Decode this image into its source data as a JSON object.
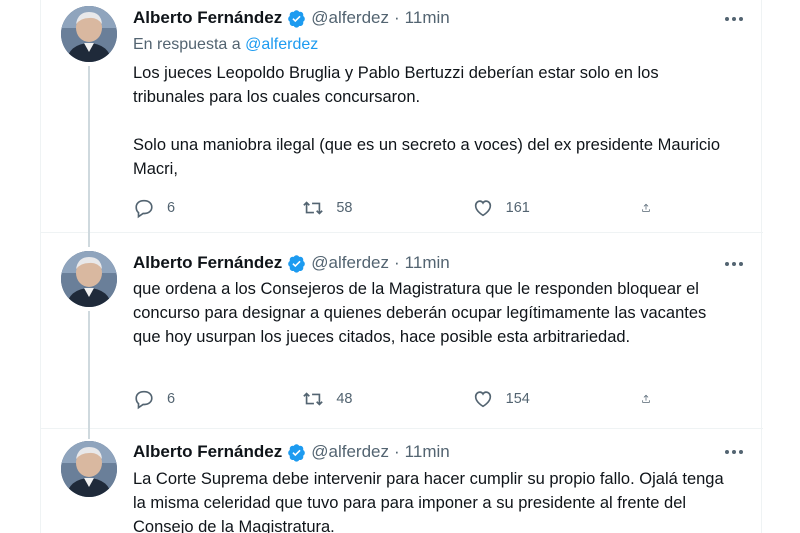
{
  "tweets": [
    {
      "author_name": "Alberto Fernández",
      "handle": "@alferdez",
      "separator": "·",
      "time": "11min",
      "reply_prefix": "En respuesta a",
      "reply_handle": "@alferdez",
      "paragraphs": [
        "Los jueces Leopoldo Bruglia y Pablo Bertuzzi deberían estar solo en los tribunales para los cuales concursaron.",
        "Solo una maniobra ilegal (que es un secreto a voces) del ex presidente Mauricio Macri,"
      ],
      "replies": "6",
      "retweets": "58",
      "likes": "161"
    },
    {
      "author_name": "Alberto Fernández",
      "handle": "@alferdez",
      "separator": "·",
      "time": "11min",
      "paragraphs": [
        "que ordena a los Consejeros de la Magistratura que le responden bloquear el concurso para designar a quienes deberán ocupar legítimamente las vacantes que hoy usurpan los jueces citados, hace posible esta arbitrariedad."
      ],
      "replies": "6",
      "retweets": "48",
      "likes": "154"
    },
    {
      "author_name": "Alberto Fernández",
      "handle": "@alferdez",
      "separator": "·",
      "time": "11min",
      "paragraphs": [
        "La Corte Suprema debe intervenir para hacer cumplir su propio fallo. Ojalá tenga la misma celeridad que tuvo para para imponer a su presidente al frente del Consejo de la Magistratura."
      ]
    }
  ],
  "icons": {
    "verified": "verified-badge-icon",
    "more": "more-dots-icon",
    "reply": "reply-bubble-icon",
    "retweet": "retweet-icon",
    "like": "heart-icon",
    "share": "share-icon"
  },
  "colors": {
    "text": "#0f1419",
    "secondary": "#536471",
    "link": "#1d9bf0",
    "verified": "#1d9bf0",
    "divider": "#eff3f4"
  }
}
